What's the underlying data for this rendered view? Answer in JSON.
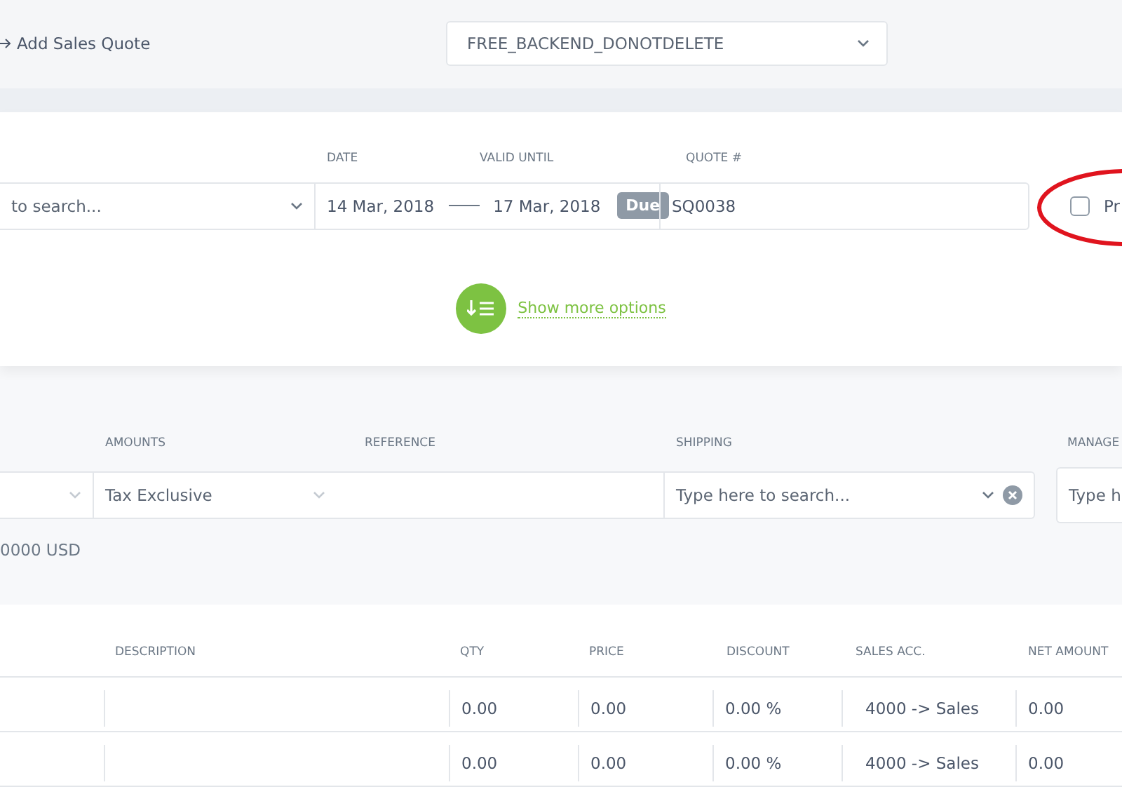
{
  "header": {
    "back_link": "Add Sales Quote",
    "company_select": "FREE_BACKEND_DONOTDELETE"
  },
  "quote": {
    "labels": {
      "date": "DATE",
      "valid_until": "VALID UNTIL",
      "quote_no": "QUOTE #"
    },
    "customer_placeholder": "to search...",
    "date": "14 Mar, 2018",
    "valid_until": "17 Mar, 2018",
    "status": "Due",
    "quote_no": "SQ0038",
    "option": {
      "label": "Pr",
      "checked": false
    },
    "more_options": "Show more options"
  },
  "details": {
    "labels": {
      "amounts": "AMOUNTS",
      "reference": "REFERENCE",
      "shipping": "SHIPPING",
      "manager": "MANAGE"
    },
    "amounts": "Tax Exclusive",
    "shipping_placeholder": "Type here to search...",
    "manager_placeholder": "Type h",
    "currency_note": "0000 USD"
  },
  "table": {
    "columns": [
      "DESCRIPTION",
      "QTY",
      "PRICE",
      "DISCOUNT",
      "SALES ACC.",
      "NET AMOUNT"
    ],
    "rows": [
      {
        "description": "",
        "qty": "0.00",
        "price": "0.00",
        "discount": "0.00 %",
        "account": "4000 -> Sales",
        "net": "0.00"
      },
      {
        "description": "",
        "qty": "0.00",
        "price": "0.00",
        "discount": "0.00 %",
        "account": "4000 -> Sales",
        "net": "0.00"
      }
    ]
  }
}
